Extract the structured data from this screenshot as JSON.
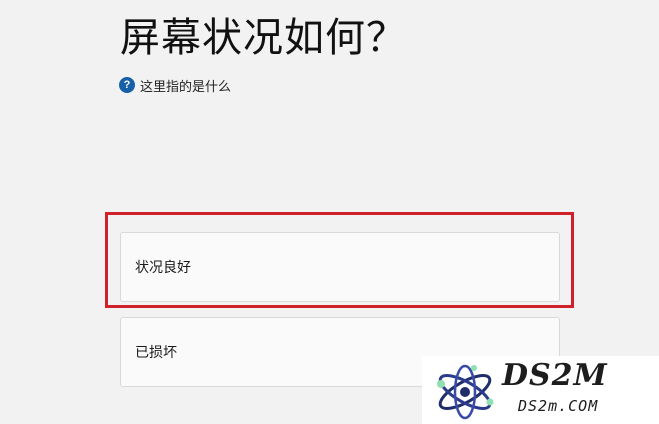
{
  "page": {
    "title": "屏幕状况如何？",
    "help_link": {
      "icon": "question-circle-icon",
      "icon_glyph": "?",
      "text": "这里指的是什么"
    }
  },
  "options": [
    {
      "label": "状况良好",
      "highlighted": true
    },
    {
      "label": "已损坏",
      "highlighted": false
    }
  ],
  "colors": {
    "background": "#f2f2f2",
    "highlight_border": "#d0212b",
    "help_icon": "#1560a8"
  },
  "watermark": {
    "brand": "DS2M",
    "url": "DS2m.COM",
    "icon": "atom-logo-icon"
  }
}
